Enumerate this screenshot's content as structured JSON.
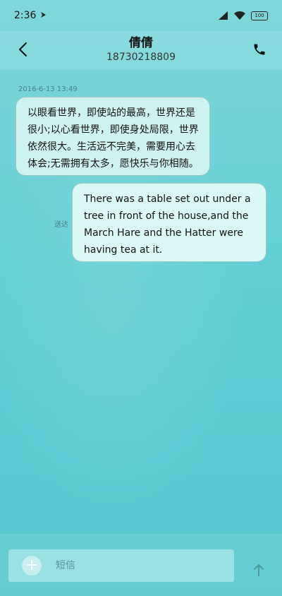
{
  "status_bar": {
    "time": "2:36",
    "battery": "100",
    "icons": [
      "notification-arrow-icon",
      "signal-icon",
      "wifi-icon",
      "battery-icon"
    ]
  },
  "header": {
    "contact_name": "倩倩",
    "contact_number": "18730218809",
    "icons": [
      "back-arrow-icon",
      "phone-icon"
    ]
  },
  "conversation": {
    "timestamp": "2016-6-13 13:49",
    "messages": [
      {
        "direction": "incoming",
        "text": "以眼看世界，即使站的最高，世界还是很小;以心看世界，即使身处局限，世界依然很大。生活远不完美，需要用心去体会;无需拥有太多，愿快乐与你相随。"
      },
      {
        "direction": "outgoing",
        "status": "送达",
        "text": "There was a table set out under a tree in front of the house,and the March Hare and the Hatter were having tea at it."
      }
    ]
  },
  "compose": {
    "placeholder": "短信",
    "value": "",
    "icons": [
      "plus-icon",
      "send-arrow-icon"
    ]
  },
  "colors": {
    "background_top": "#7fd6da",
    "background_bottom": "#55c8d0",
    "bubble": "#d6f4f2",
    "muted_text": "#4b7f86"
  }
}
